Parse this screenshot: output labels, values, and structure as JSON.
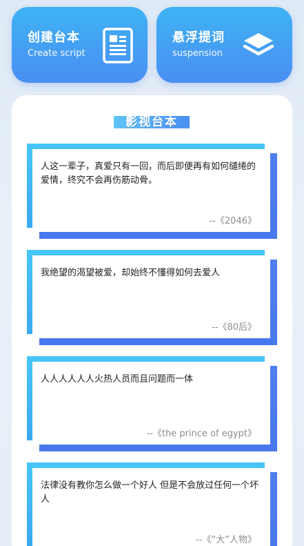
{
  "buttons": {
    "create": {
      "title": "创建台本",
      "subtitle": "Create script",
      "icon": "document-icon"
    },
    "float": {
      "title": "悬浮提词",
      "subtitle": "suspension",
      "icon": "layers-icon"
    }
  },
  "panel": {
    "title": "影视台本"
  },
  "cards": [
    {
      "quote": "人这一辈子，真爱只有一回，而后即便再有如何缱绻的爱情，终究不会再伤筋动骨。",
      "source": "--《2046》"
    },
    {
      "quote": "我绝望的渴望被爱，却始终不懂得如何去爱人",
      "source": "--《80后》"
    },
    {
      "quote": "人人人人人人火热人员而且问题而一体",
      "source": "--《the prince of egypt》"
    },
    {
      "quote": "法律没有教你怎么做一个好人 但是不会放过任何一个坏人",
      "source": "--《“大”人物》"
    }
  ],
  "colors": {
    "accent_top": "#3fb3f4",
    "accent_bottom": "#4a8ef2",
    "card_cyan": "#48c6f7",
    "card_blue": "#4f7ff0"
  }
}
